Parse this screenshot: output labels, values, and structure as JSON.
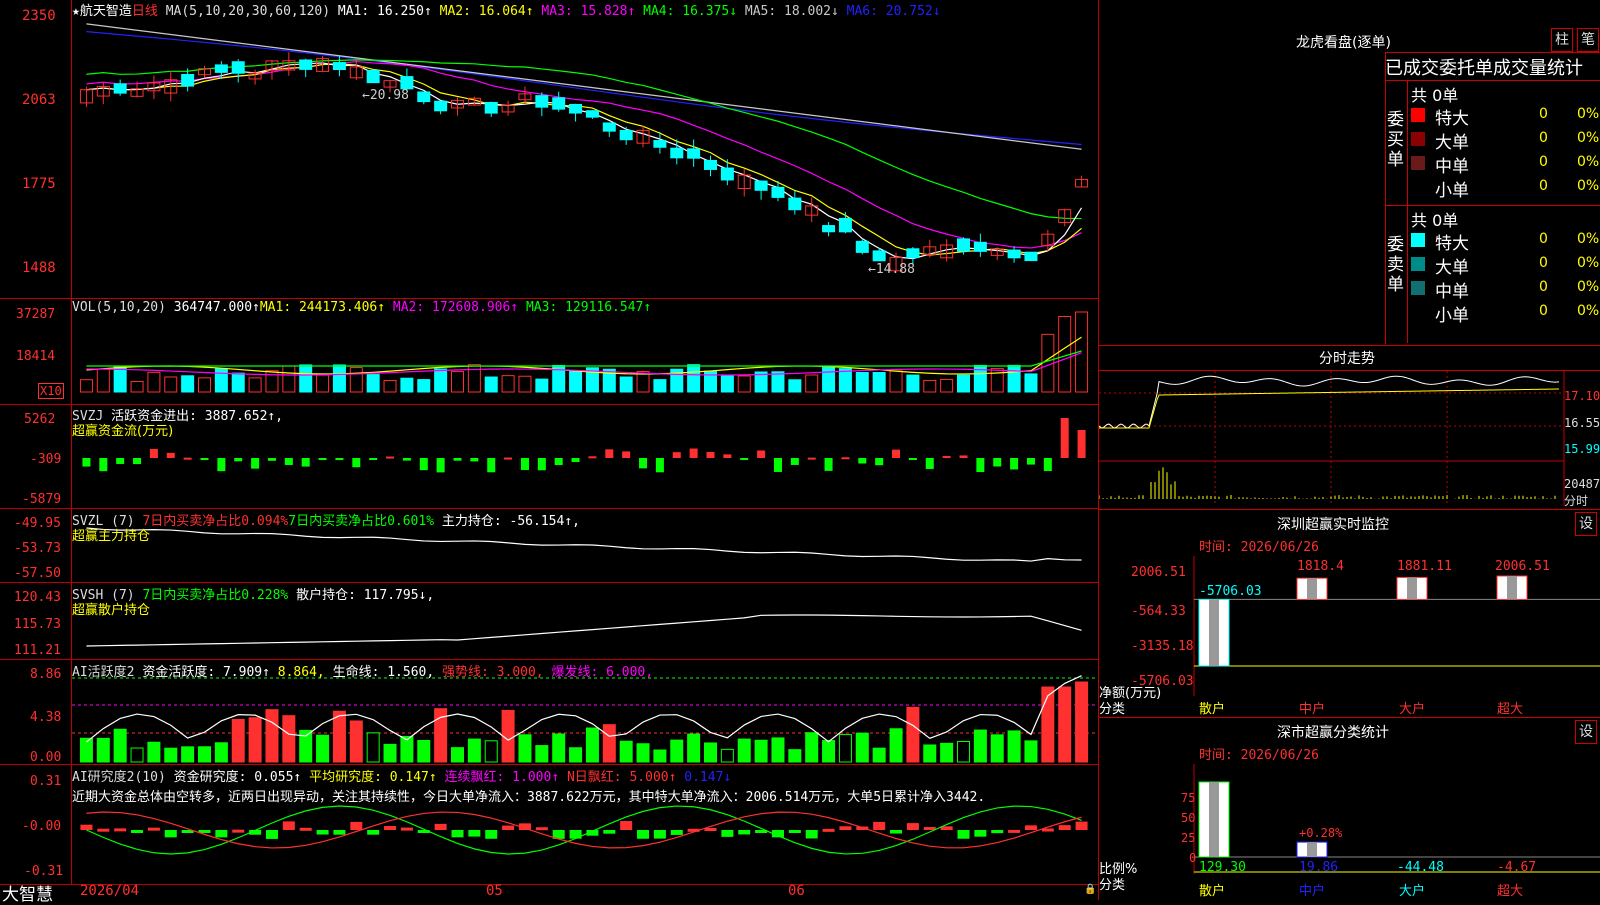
{
  "stock": {
    "star": "★",
    "name": "航天智造",
    "period": "日线"
  },
  "colors": {
    "up": "#ff3030",
    "down": "#00ffff",
    "ma1": "#ffffff",
    "ma2": "#ffff00",
    "ma3": "#ff00ff",
    "ma4": "#00ff00",
    "ma5": "#c8c8c8",
    "ma6": "#2222ff",
    "axis": "#c00000",
    "green": "#00ff00",
    "yellow": "#ffff00"
  },
  "price": {
    "ma_title": "MA(5,10,20,30,60,120)",
    "ma_vals": [
      "MA1: 16.250↑",
      "MA2: 16.064↑",
      "MA3: 15.828↑",
      "MA4: 16.375↓",
      "MA5: 18.002↓",
      "MA6: 20.752↓"
    ],
    "yticks": [
      "2350",
      "2063",
      "1775",
      "1488"
    ],
    "high_label": "←20.98",
    "low_label": "←14.88"
  },
  "vol": {
    "title": "VOL(5,10,20)",
    "vals": [
      "364747.000↑",
      "MA1: 244173.406↑",
      "MA2: 172608.906↑",
      "MA3: 129116.547↑"
    ],
    "yticks": [
      "37287",
      "18414"
    ],
    "unit": "X10"
  },
  "svzj": {
    "title": "SVZJ",
    "val": "活跃资金进出: 3887.652↑,",
    "sub": "超赢资金流(万元)",
    "yticks": [
      "5262",
      "-309",
      "-5879"
    ]
  },
  "svzl": {
    "title": "SVZL (7)",
    "a": "7日内买卖净占比0.094%",
    "b": "7日内买卖净占比0.601%",
    "c": "主力持仓: -56.154↑,",
    "sub": "超赢主力持仓",
    "yticks": [
      "-49.95",
      "-53.73",
      "-57.50"
    ]
  },
  "svsh": {
    "title": "SVSH (7)",
    "a": "7日内买卖净占比0.228%",
    "b": "散户持仓: 117.795↓,",
    "sub": "超赢散户持仓",
    "yticks": [
      "120.43",
      "115.73",
      "111.21"
    ]
  },
  "ai1": {
    "title": "AI活跃度2",
    "a": "资金活跃度: 7.909↑",
    "b": "8.864,",
    "c": "生命线: 1.560,",
    "d": "强势线: 3.000,",
    "e": "爆发线: 6.000,",
    "yticks": [
      "8.86",
      "4.38",
      "0.00"
    ]
  },
  "ai2": {
    "title": "AI研究度2(10)",
    "a": "资金研究度: 0.055↑",
    "b": "平均研究度: 0.147↑",
    "c": "连续飘红: 1.000↑",
    "d": "N日飘红: 5.000↑",
    "e": "0.147↓",
    "comment": "近期大资金总体由空转多，近两日出现异动，关注其持续性，今日大单净流入：3887.622万元，其中特大单净流入：2006.514万元，大单5日累计净入3442.",
    "yticks": [
      "0.31",
      "-0.00",
      "-0.31"
    ]
  },
  "footer": {
    "brand": "大智慧",
    "dates": [
      "2026/04",
      "05",
      "06"
    ]
  },
  "right": {
    "lhkp_title": "龙虎看盘(逐单)",
    "btn_zhu": "柱",
    "btn_bi": "笔",
    "lhkp_sub": "已成交委托单成交量统计",
    "buy": {
      "label": "委买单",
      "total": "共 0单",
      "rows": [
        {
          "name": "特大",
          "val": "0",
          "pct": "0%"
        },
        {
          "name": "大单",
          "val": "0",
          "pct": "0%"
        },
        {
          "name": "中单",
          "val": "0",
          "pct": "0%"
        },
        {
          "name": "小单",
          "val": "0",
          "pct": "0%"
        }
      ]
    },
    "sell": {
      "label": "委卖单",
      "total": "共 0单",
      "rows": [
        {
          "name": "特大",
          "val": "0",
          "pct": "0%"
        },
        {
          "name": "大单",
          "val": "0",
          "pct": "0%"
        },
        {
          "name": "中单",
          "val": "0",
          "pct": "0%"
        },
        {
          "name": "小单",
          "val": "0",
          "pct": "0%"
        }
      ]
    },
    "ts_title": "分时走势",
    "ts_yticks": [
      "17.10",
      "16.55",
      "15.99",
      "20487"
    ],
    "ts_unit": "分时",
    "mon_title": "深圳超赢实时监控",
    "mon_btn": "设",
    "mon_time": "时间: 2026/06/26",
    "mon_yticks": [
      "2006.51",
      "-564.33",
      "-3135.18",
      "-5706.03"
    ],
    "mon_unit": "净额(万元)",
    "mon_unit2": "分类",
    "mon_cats": [
      "散户",
      "中户",
      "大户",
      "超大"
    ],
    "mon_vals": [
      "-5706.03",
      "1818.4",
      "1881.11",
      "2006.51"
    ],
    "cls_title": "深市超赢分类统计",
    "cls_btn": "设",
    "cls_time": "时间: 2026/06/26",
    "cls_yticks": [
      "75",
      "50",
      "25",
      "0"
    ],
    "cls_unit": "比例%",
    "cls_unit2": "分类",
    "cls_cats": [
      "散户",
      "中户",
      "大户",
      "超大"
    ],
    "cls_vals": [
      "129.30",
      "19.86",
      "-44.48",
      "-4.67"
    ],
    "cls_note": "+0.28%"
  },
  "chart_data": [
    {
      "type": "candlestick",
      "title": "航天智造 日线",
      "ylim": [
        14.88,
        20.98
      ],
      "series": [
        {
          "name": "MA1",
          "value": 16.25
        },
        {
          "name": "MA2",
          "value": 16.064
        },
        {
          "name": "MA3",
          "value": 15.828
        },
        {
          "name": "MA4",
          "value": 16.375
        },
        {
          "name": "MA5",
          "value": 18.002
        },
        {
          "name": "MA6",
          "value": 20.752
        }
      ],
      "annotations": {
        "high": 20.98,
        "low": 14.88
      }
    },
    {
      "type": "bar",
      "title": "VOL(5,10,20)",
      "values_latest": [
        364747.0
      ],
      "ma": [
        244173.406,
        172608.906,
        129116.547
      ]
    },
    {
      "type": "bar",
      "title": "SVZJ",
      "latest": 3887.652
    },
    {
      "type": "line",
      "title": "SVZL (7)",
      "latest": -56.154
    },
    {
      "type": "line",
      "title": "SVSH (7)",
      "latest": 117.795
    },
    {
      "type": "bar",
      "title": "AI活跃度2",
      "latest": [
        7.909,
        8.864
      ],
      "lines": [
        1.56,
        3.0,
        6.0
      ]
    },
    {
      "type": "bar",
      "title": "AI研究度2(10)",
      "latest": [
        0.055,
        0.147
      ]
    },
    {
      "type": "bar",
      "title": "深圳超赢实时监控",
      "categories": [
        "散户",
        "中户",
        "大户",
        "超大"
      ],
      "values": [
        -5706.03,
        1818.4,
        1881.11,
        2006.51
      ]
    },
    {
      "type": "bar",
      "title": "深市超赢分类统计",
      "categories": [
        "散户",
        "中户",
        "大户",
        "超大"
      ],
      "values": [
        129.3,
        19.86,
        -44.48,
        -4.67
      ]
    }
  ]
}
